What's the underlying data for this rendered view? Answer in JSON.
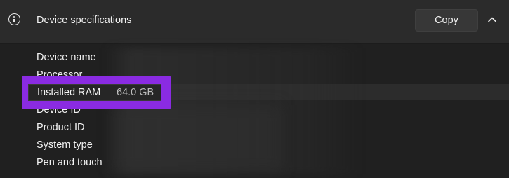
{
  "header": {
    "title": "Device specifications",
    "copy_label": "Copy",
    "info_icon": "info-icon",
    "chevron_icon": "chevron-up-icon"
  },
  "specs": {
    "device_name": "Device name",
    "processor": "Processor",
    "installed_ram_label": "Installed RAM",
    "installed_ram_value": "64.0 GB",
    "device_id": "Device ID",
    "product_id": "Product ID",
    "system_type": "System type",
    "pen_and_touch": "Pen and touch"
  },
  "colors": {
    "background": "#202020",
    "header_background": "#2b2b2b",
    "highlight_accent": "#8a2be2"
  }
}
